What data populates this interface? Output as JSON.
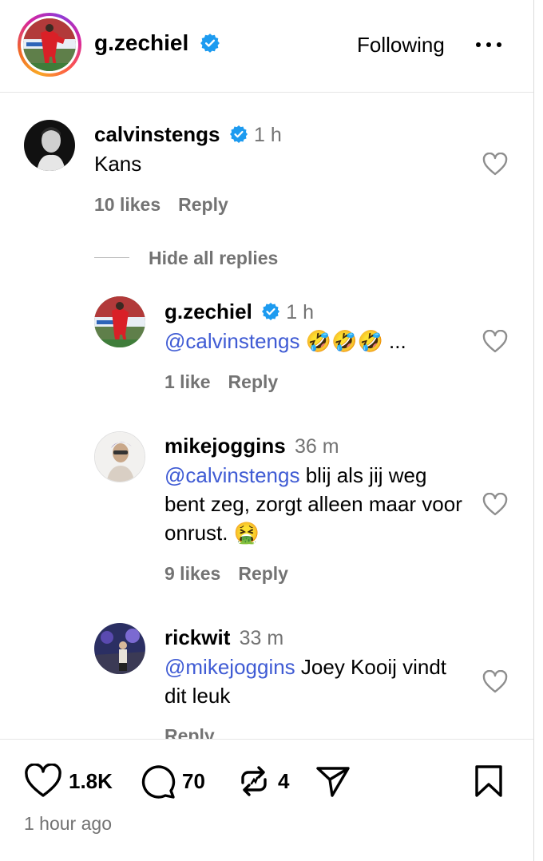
{
  "header": {
    "username": "g.zechiel",
    "follow_label": "Following",
    "verified": true
  },
  "comments": [
    {
      "username": "calvinstengs",
      "verified": true,
      "time": "1 h",
      "text": "Kans",
      "likes": "10 likes",
      "reply_label": "Reply"
    }
  ],
  "replies_toggle": "Hide all replies",
  "replies": [
    {
      "username": "g.zechiel",
      "verified": true,
      "time": "1 h",
      "mention": "@calvinstengs",
      "text": " 🤣🤣🤣 ...",
      "likes": "1 like",
      "reply_label": "Reply"
    },
    {
      "username": "mikejoggins",
      "verified": false,
      "time": "36 m",
      "mention": "@calvinstengs",
      "text": " blij als jij weg bent zeg, zorgt alleen maar voor onrust. 🤮",
      "likes": "9 likes",
      "reply_label": "Reply"
    },
    {
      "username": "rickwit",
      "verified": false,
      "time": "33 m",
      "mention": "@mikejoggins",
      "text": " Joey Kooij vindt dit leuk",
      "reply_label": "Reply"
    }
  ],
  "footer": {
    "like_count": "1.8K",
    "comment_count": "70",
    "repost_count": "4",
    "time_ago": "1 hour ago"
  },
  "colors": {
    "mention": "#3f5bd4",
    "verified": "#1d9bf0",
    "muted": "#737373"
  },
  "icons": [
    "more-icon",
    "verified-badge-icon",
    "heart-icon",
    "comment-icon",
    "repost-icon",
    "share-icon",
    "bookmark-icon"
  ]
}
